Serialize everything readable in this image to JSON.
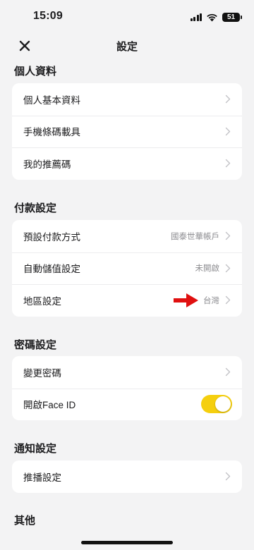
{
  "status_bar": {
    "time": "15:09",
    "battery": "51"
  },
  "header": {
    "title": "設定",
    "close_icon": "close-icon"
  },
  "sections": {
    "profile": {
      "title": "個人資料",
      "items": [
        {
          "label": "個人基本資料"
        },
        {
          "label": "手機條碼載具"
        },
        {
          "label": "我的推薦碼"
        }
      ]
    },
    "payment": {
      "title": "付款設定",
      "items": [
        {
          "label": "預設付款方式",
          "value": "國泰世華帳戶"
        },
        {
          "label": "自動儲值設定",
          "value": "未開啟"
        },
        {
          "label": "地區設定",
          "value": "台灣"
        }
      ]
    },
    "password": {
      "title": "密碼設定",
      "items": [
        {
          "label": "變更密碼"
        },
        {
          "label": "開啟Face ID",
          "toggle_on": true
        }
      ]
    },
    "notification": {
      "title": "通知設定",
      "items": [
        {
          "label": "推播設定"
        }
      ]
    },
    "other": {
      "title": "其他"
    }
  },
  "colors": {
    "background": "#f3f3f4",
    "card": "#ffffff",
    "toggle_on": "#f5cf0e",
    "annotation_arrow": "#e01010",
    "secondary_text": "#8c8c90"
  }
}
